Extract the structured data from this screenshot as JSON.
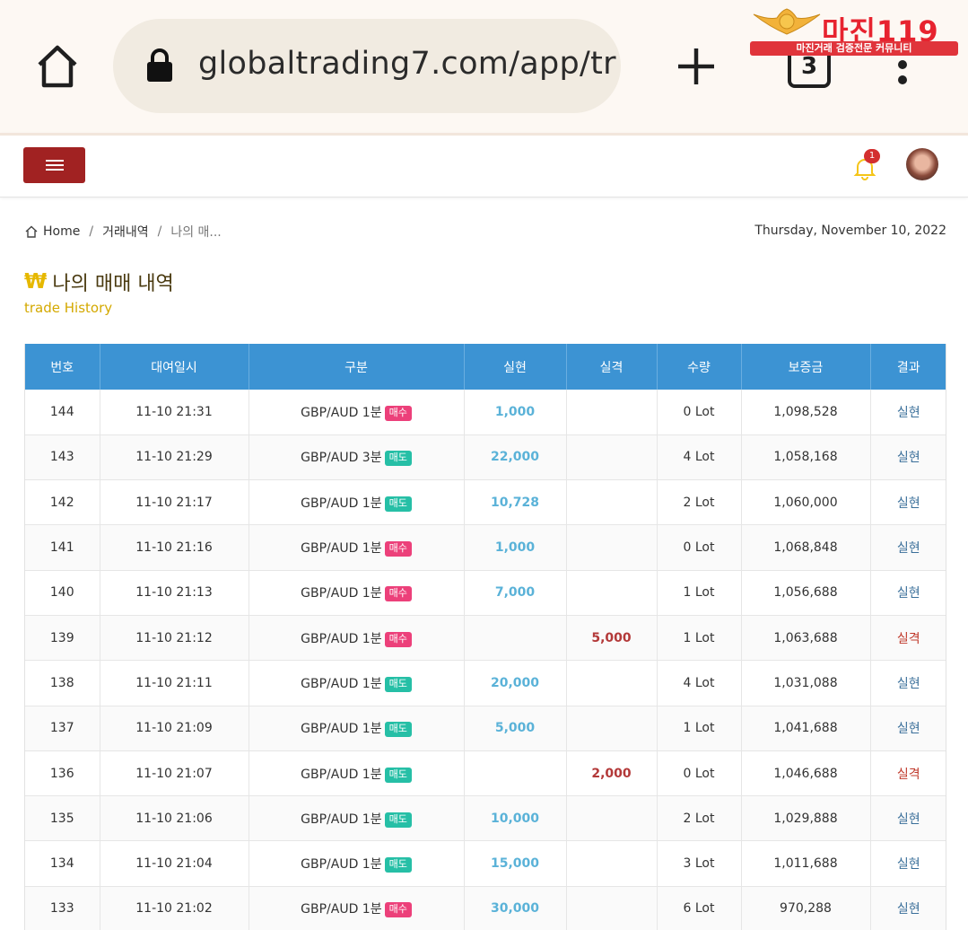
{
  "browser": {
    "url": "globaltrading7.com/app/tr",
    "tab_count": "3"
  },
  "watermark": {
    "title": "마진119",
    "subtitle": "마진거래 검증전문 커뮤니티"
  },
  "header": {
    "notification_count": "1"
  },
  "breadcrumb": {
    "home": "Home",
    "level2": "거래내역",
    "current": "나의 매..."
  },
  "date": "Thursday, November 10, 2022",
  "page": {
    "title_icon": "₩",
    "title": "나의 매매 내역",
    "subtitle": "trade History"
  },
  "table": {
    "headers": [
      "번호",
      "대여일시",
      "구분",
      "실현",
      "실격",
      "수량",
      "보증금",
      "결과"
    ],
    "rows": [
      {
        "no": "144",
        "time": "11-10 21:31",
        "product": "GBP/AUD 1분",
        "side": "매수",
        "realized": "1,000",
        "lost": "",
        "qty": "0 Lot",
        "deposit": "1,098,528",
        "result": "실현"
      },
      {
        "no": "143",
        "time": "11-10 21:29",
        "product": "GBP/AUD 3분",
        "side": "매도",
        "realized": "22,000",
        "lost": "",
        "qty": "4 Lot",
        "deposit": "1,058,168",
        "result": "실현"
      },
      {
        "no": "142",
        "time": "11-10 21:17",
        "product": "GBP/AUD 1분",
        "side": "매도",
        "realized": "10,728",
        "lost": "",
        "qty": "2 Lot",
        "deposit": "1,060,000",
        "result": "실현"
      },
      {
        "no": "141",
        "time": "11-10 21:16",
        "product": "GBP/AUD 1분",
        "side": "매수",
        "realized": "1,000",
        "lost": "",
        "qty": "0 Lot",
        "deposit": "1,068,848",
        "result": "실현"
      },
      {
        "no": "140",
        "time": "11-10 21:13",
        "product": "GBP/AUD 1분",
        "side": "매수",
        "realized": "7,000",
        "lost": "",
        "qty": "1 Lot",
        "deposit": "1,056,688",
        "result": "실현"
      },
      {
        "no": "139",
        "time": "11-10 21:12",
        "product": "GBP/AUD 1분",
        "side": "매수",
        "realized": "",
        "lost": "5,000",
        "qty": "1 Lot",
        "deposit": "1,063,688",
        "result": "실격"
      },
      {
        "no": "138",
        "time": "11-10 21:11",
        "product": "GBP/AUD 1분",
        "side": "매도",
        "realized": "20,000",
        "lost": "",
        "qty": "4 Lot",
        "deposit": "1,031,088",
        "result": "실현"
      },
      {
        "no": "137",
        "time": "11-10 21:09",
        "product": "GBP/AUD 1분",
        "side": "매도",
        "realized": "5,000",
        "lost": "",
        "qty": "1 Lot",
        "deposit": "1,041,688",
        "result": "실현"
      },
      {
        "no": "136",
        "time": "11-10 21:07",
        "product": "GBP/AUD 1분",
        "side": "매도",
        "realized": "",
        "lost": "2,000",
        "qty": "0 Lot",
        "deposit": "1,046,688",
        "result": "실격"
      },
      {
        "no": "135",
        "time": "11-10 21:06",
        "product": "GBP/AUD 1분",
        "side": "매도",
        "realized": "10,000",
        "lost": "",
        "qty": "2 Lot",
        "deposit": "1,029,888",
        "result": "실현"
      },
      {
        "no": "134",
        "time": "11-10 21:04",
        "product": "GBP/AUD 1분",
        "side": "매도",
        "realized": "15,000",
        "lost": "",
        "qty": "3 Lot",
        "deposit": "1,011,688",
        "result": "실현"
      },
      {
        "no": "133",
        "time": "11-10 21:02",
        "product": "GBP/AUD 1분",
        "side": "매수",
        "realized": "30,000",
        "lost": "",
        "qty": "6 Lot",
        "deposit": "970,288",
        "result": "실현"
      }
    ]
  },
  "colors": {
    "header_bg": "#3c93d3",
    "menu_button": "#a12222",
    "buy_pill": "#ec407a",
    "sell_pill": "#26bfa6",
    "profit_text": "#5ab2d8",
    "loss_text": "#b33939"
  }
}
